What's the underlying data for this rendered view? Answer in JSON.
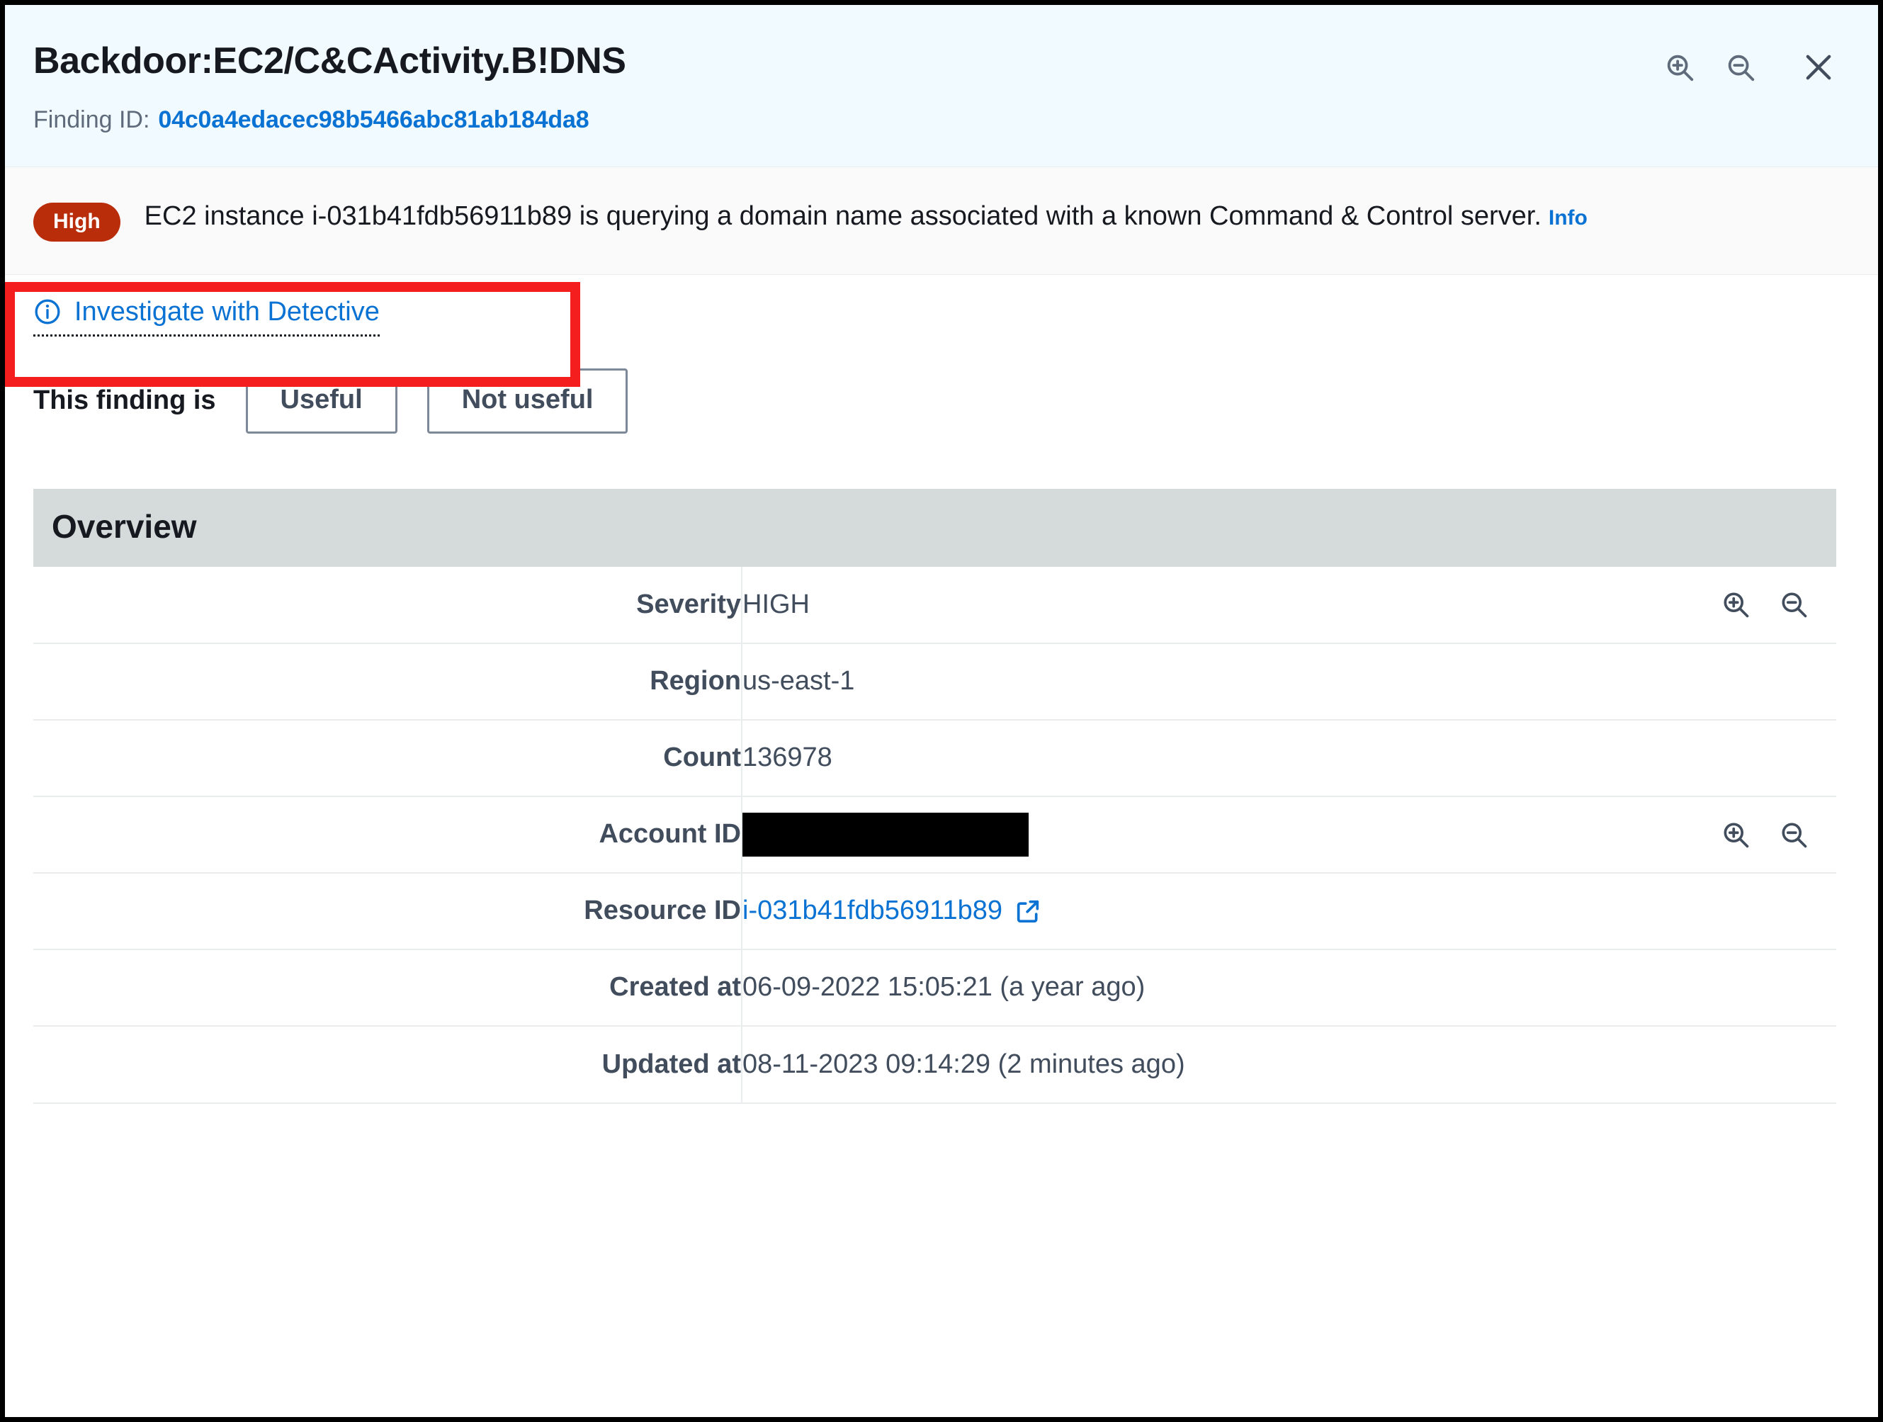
{
  "header": {
    "title": "Backdoor:EC2/C&CActivity.B!DNS",
    "finding_id_label": "Finding ID:",
    "finding_id_value": "04c0a4edacec98b5466abc81ab184da8",
    "actions": [
      {
        "name": "zoom-in-icon",
        "label": "Zoom in"
      },
      {
        "name": "zoom-out-icon",
        "label": "Zoom out"
      },
      {
        "name": "close-icon",
        "label": "Close"
      }
    ]
  },
  "description": {
    "severity_badge": "High",
    "severity_badge_color": "#ba2d0b",
    "text": "EC2 instance i-031b41fdb56911b89 is querying a domain name associated with a known Command & Control server.",
    "info_link": "Info"
  },
  "detective": {
    "link_label": "Investigate with Detective",
    "highlight_color": "#f41e1e"
  },
  "feedback": {
    "label": "This finding is",
    "useful_label": "Useful",
    "not_useful_label": "Not useful"
  },
  "overview": {
    "title": "Overview",
    "rows": [
      {
        "key": "Severity",
        "value": "HIGH",
        "type": "text",
        "icons": true
      },
      {
        "key": "Region",
        "value": "us-east-1",
        "type": "text",
        "icons": false
      },
      {
        "key": "Count",
        "value": "136978",
        "type": "text",
        "icons": false
      },
      {
        "key": "Account ID",
        "value": "",
        "type": "redacted",
        "icons": true
      },
      {
        "key": "Resource ID",
        "value": "i-031b41fdb56911b89",
        "type": "link",
        "icons": false
      },
      {
        "key": "Created at",
        "value": "06-09-2022 15:05:21 (a year ago)",
        "type": "text",
        "icons": false
      },
      {
        "key": "Updated at",
        "value": "08-11-2023 09:14:29 (2 minutes ago)",
        "type": "text",
        "icons": false
      }
    ]
  },
  "colors": {
    "link": "#0972d3",
    "header_band": "#f1faff",
    "desc_band": "#fafafa",
    "table_header": "#d5dbdb"
  }
}
